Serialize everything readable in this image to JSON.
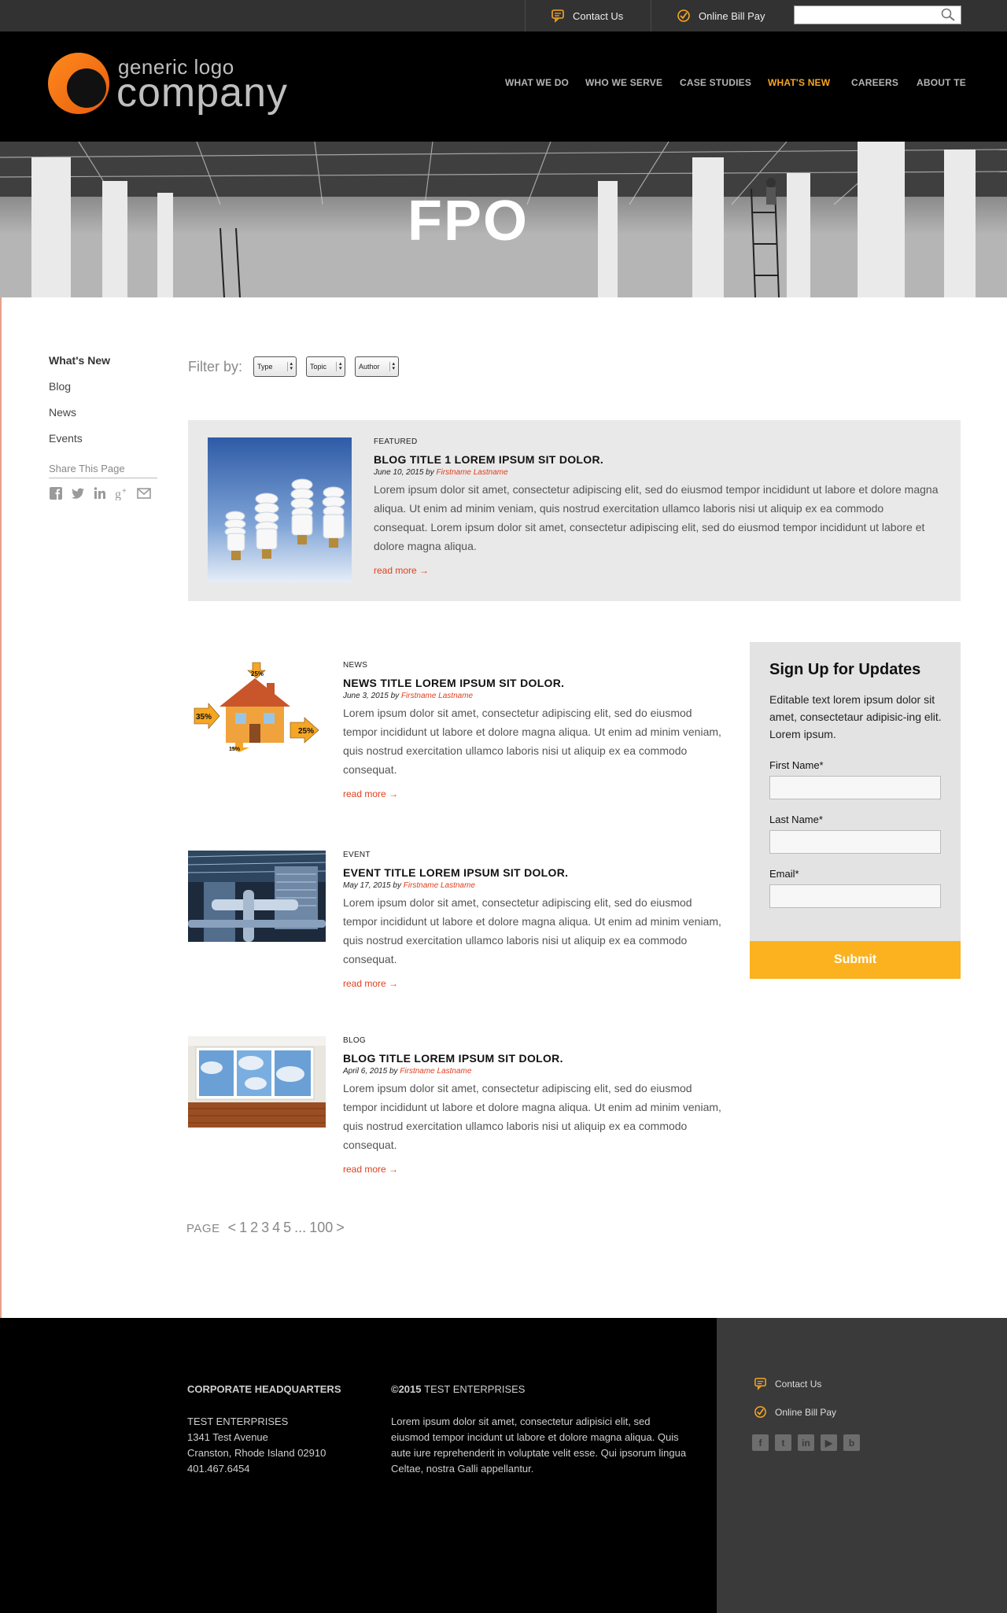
{
  "utility": {
    "contact_label": "Contact Us",
    "billpay_label": "Online Bill Pay",
    "search_placeholder": ""
  },
  "logo": {
    "line1": "generic logo",
    "line2": "company"
  },
  "nav": {
    "items": [
      "WHAT WE DO",
      "WHO WE SERVE",
      "CASE STUDIES",
      "WHAT'S NEW",
      "CAREERS",
      "ABOUT TE"
    ],
    "active": "WHAT'S NEW"
  },
  "hero": {
    "title": "FPO"
  },
  "sidebar": {
    "items": [
      "What's New",
      "Blog",
      "News",
      "Events"
    ],
    "share_label": "Share This Page"
  },
  "filter": {
    "label": "Filter by:",
    "selects": [
      "Type",
      "Topic",
      "Author"
    ]
  },
  "featured": {
    "type": "FEATURED",
    "title": "BLOG TITLE 1 LOREM IPSUM SIT DOLOR.",
    "date": "June 10, 2015",
    "by": "by",
    "author": "Firstname Lastname",
    "excerpt": "Lorem ipsum dolor sit amet, consectetur adipiscing elit, sed do eiusmod tempor incididunt ut labore et dolore magna aliqua. Ut enim ad minim veniam, quis nostrud exercitation ullamco laboris nisi ut aliquip ex ea commodo consequat. Lorem ipsum dolor sit amet, consectetur adipiscing elit, sed do eiusmod tempor incididunt ut labore et dolore magna aliqua.",
    "readmore": "read more →"
  },
  "posts": [
    {
      "type": "NEWS",
      "title": "NEWS TITLE LOREM IPSUM SIT DOLOR.",
      "date": "June 3, 2015",
      "by": "by",
      "author": "Firstname Lastname",
      "excerpt": "Lorem ipsum dolor sit amet, consectetur adipiscing elit, sed do eiusmod tempor incididunt ut labore et dolore magna aliqua. Ut enim ad minim veniam, quis nostrud exercitation ullamco laboris nisi ut aliquip ex ea commodo consequat.",
      "readmore": "read more →",
      "image_labels": {
        "roof": "25%",
        "walls": "35%",
        "windows": "25%",
        "floor": "15%"
      }
    },
    {
      "type": "EVENT",
      "title": "EVENT TITLE LOREM IPSUM SIT DOLOR.",
      "date": "May 17, 2015",
      "by": "by",
      "author": "Firstname Lastname",
      "excerpt": "Lorem ipsum dolor sit amet, consectetur adipiscing elit, sed do eiusmod tempor incididunt ut labore et dolore magna aliqua. Ut enim ad minim veniam, quis nostrud exercitation ullamco laboris nisi ut aliquip ex ea commodo consequat.",
      "readmore": "read more →"
    },
    {
      "type": "BLOG",
      "title": "BLOG TITLE LOREM IPSUM SIT DOLOR.",
      "date": "April 6, 2015",
      "by": "by",
      "author": "Firstname Lastname",
      "excerpt": "Lorem ipsum dolor sit amet, consectetur adipiscing elit, sed do eiusmod tempor incididunt ut labore et dolore magna aliqua. Ut enim ad minim veniam, quis nostrud exercitation ullamco laboris nisi ut aliquip ex ea commodo consequat.",
      "readmore": "read more →"
    }
  ],
  "signup": {
    "title": "Sign Up for Updates",
    "text": "Editable text lorem ipsum dolor sit amet, consectetaur adipisic-ing elit. Lorem ipsum.",
    "first_name": "First Name*",
    "last_name": "Last Name*",
    "email": "Email*",
    "submit": "Submit"
  },
  "pagination": {
    "label": "PAGE",
    "prev": "<",
    "pages": [
      "1",
      "2",
      "3",
      "4",
      "5"
    ],
    "ellipsis": "...",
    "last": "100",
    "next": ">"
  },
  "footer": {
    "hq_title": "CORPORATE HEADQUARTERS",
    "company": "TEST ENTERPRISES",
    "address1": "1341 Test Avenue",
    "address2": "Cranston, Rhode Island 02910",
    "phone": "401.467.6454",
    "copyright_prefix": "©2015",
    "copyright_name": "TEST ENTERPRISES",
    "blurb": "Lorem ipsum dolor sit amet, consectetur adipisici elit, sed eiusmod tempor incidunt ut labore et dolore magna aliqua. Quis aute iure reprehenderit in voluptate velit esse. Qui ipsorum lingua Celtae, nostra Galli appellantur.",
    "contact_label": "Contact Us",
    "billpay_label": "Online Bill Pay",
    "social": [
      "facebook-icon",
      "twitter-icon",
      "linkedin-icon",
      "youtube-icon",
      "blog-icon"
    ]
  },
  "colors": {
    "accent": "#fbb21e",
    "nav_active": "#f5a623",
    "link": "#e0401f",
    "header_bg": "#000000",
    "utility_bg": "#323232"
  }
}
